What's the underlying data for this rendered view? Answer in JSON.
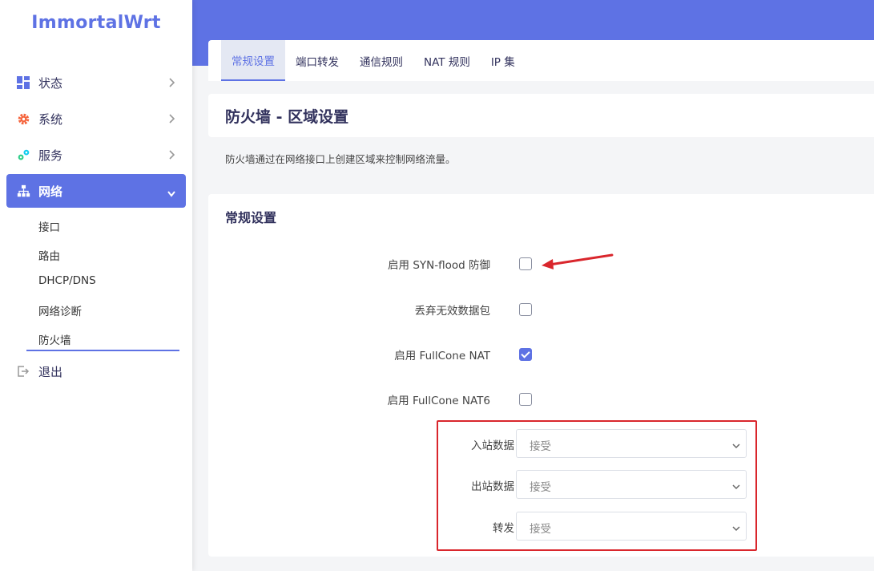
{
  "brand": "ImmortalWrt",
  "sidebar": {
    "items": [
      {
        "label": "状态",
        "icon": "dashboard-icon"
      },
      {
        "label": "系统",
        "icon": "gear-icon"
      },
      {
        "label": "服务",
        "icon": "gears-icon"
      },
      {
        "label": "网络",
        "icon": "sitemap-icon"
      },
      {
        "label": "退出",
        "icon": "logout-icon"
      }
    ],
    "network_sub": [
      "接口",
      "路由",
      "DHCP/DNS",
      "网络诊断",
      "防火墙"
    ]
  },
  "tabs": [
    "常规设置",
    "端口转发",
    "通信规则",
    "NAT 规则",
    "IP 集"
  ],
  "page": {
    "title": "防火墙 - 区域设置",
    "description": "防火墙通过在网络接口上创建区域来控制网络流量。"
  },
  "settings": {
    "heading": "常规设置",
    "options": [
      {
        "label": "启用 SYN-flood 防御",
        "checked": false
      },
      {
        "label": "丢弃无效数据包",
        "checked": false
      },
      {
        "label": "启用 FullCone NAT",
        "checked": true
      },
      {
        "label": "启用 FullCone NAT6",
        "checked": false
      }
    ],
    "policies": [
      {
        "label": "入站数据",
        "value": "接受"
      },
      {
        "label": "出站数据",
        "value": "接受"
      },
      {
        "label": "转发",
        "value": "接受"
      }
    ]
  },
  "colors": {
    "accent": "#5e72e4",
    "annotation": "#d9262c"
  }
}
